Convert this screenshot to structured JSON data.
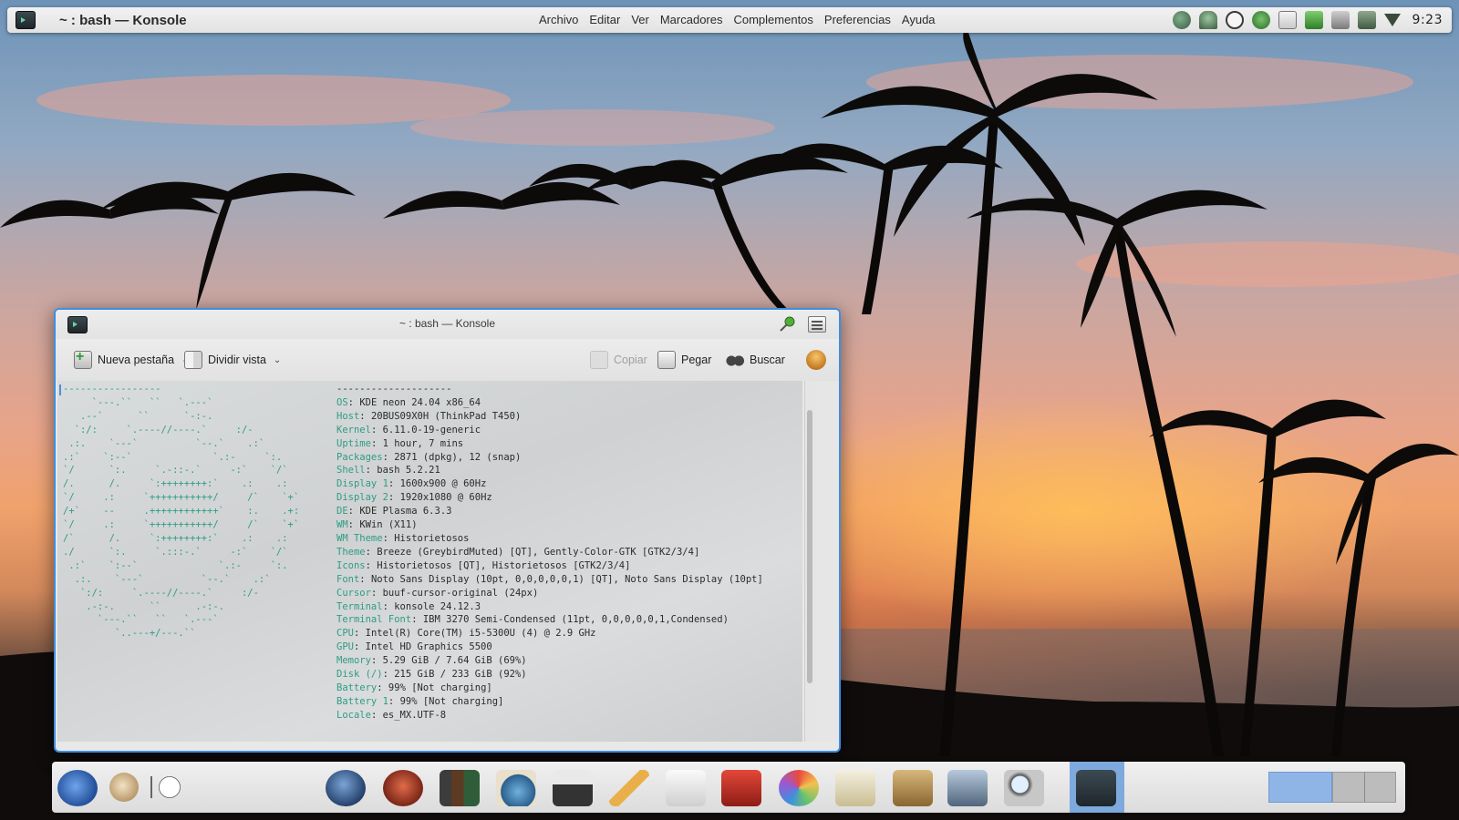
{
  "top_panel": {
    "title": "~ : bash — Konsole",
    "menu": [
      "Archivo",
      "Editar",
      "Ver",
      "Marcadores",
      "Complementos",
      "Preferencias",
      "Ayuda"
    ],
    "tray_icons": [
      "updates-icon",
      "network-share-icon",
      "vpn-icon",
      "bluetooth-icon",
      "clipboard-icon",
      "battery-icon",
      "notes-icon",
      "volume-icon",
      "wifi-icon"
    ],
    "clock": "9:23"
  },
  "konsole": {
    "title": "~ : bash — Konsole",
    "toolbar": {
      "new_tab": "Nueva pestaña",
      "split_view": "Dividir vista",
      "copy": "Copiar",
      "paste": "Pegar",
      "find": "Buscar"
    },
    "logo": "-----------------\n     `---.``   ``   `.---`\n   .--`      ``      `-:-.\n  `:/:     `.----//----.`     :/-\n .:.    `---`          `--.`    .:`\n.:`    `:--`              `.:-     `:.\n`/      `:.     `.-::-.`     -:`    `/`\n/.      /.     `:++++++++:`    .:    .:\n`/     .:     `+++++++++++/     /`    `+`\n/+`    --     .++++++++++++`    :.    .+:\n`/     .:     `+++++++++++/     /`    `+`\n/`      /.     `:++++++++:`    .:    .:\n./      `:.     `.:::-.`     -:`    `/`\n .:`    `:--`              `.:-     `:.\n  .:.    `---`          `--.`    .:`\n   `:/:     `.----//----.`     :/-\n    .-:-.      ``      .-:-.\n      `---.``   ``   `.---`\n         `..---+/---.``",
    "info": [
      {
        "k": "",
        "v": "--------------------"
      },
      {
        "k": "OS",
        "v": "KDE neon 24.04 x86_64"
      },
      {
        "k": "Host",
        "v": "20BUS09X0H (ThinkPad T450)"
      },
      {
        "k": "Kernel",
        "v": "6.11.0-19-generic"
      },
      {
        "k": "Uptime",
        "v": "1 hour, 7 mins"
      },
      {
        "k": "Packages",
        "v": "2871 (dpkg), 12 (snap)"
      },
      {
        "k": "Shell",
        "v": "bash 5.2.21"
      },
      {
        "k": "Display 1",
        "v": "1600x900 @ 60Hz"
      },
      {
        "k": "Display 2",
        "v": "1920x1080 @ 60Hz"
      },
      {
        "k": "DE",
        "v": "KDE Plasma 6.3.3"
      },
      {
        "k": "WM",
        "v": "KWin (X11)"
      },
      {
        "k": "WM Theme",
        "v": "Historietosos"
      },
      {
        "k": "Theme",
        "v": "Breeze (GreybirdMuted) [QT], Gently-Color-GTK [GTK2/3/4]"
      },
      {
        "k": "Icons",
        "v": "Historietosos [QT], Historietosos [GTK2/3/4]"
      },
      {
        "k": "Font",
        "v": "Noto Sans Display (10pt, 0,0,0,0,0,1) [QT], Noto Sans Display (10pt]"
      },
      {
        "k": "Cursor",
        "v": "buuf-cursor-original (24px)"
      },
      {
        "k": "Terminal",
        "v": "konsole 24.12.3"
      },
      {
        "k": "Terminal Font",
        "v": "IBM 3270 Semi-Condensed (11pt, 0,0,0,0,0,1,Condensed)"
      },
      {
        "k": "CPU",
        "v": "Intel(R) Core(TM) i5-5300U (4) @ 2.9 GHz"
      },
      {
        "k": "GPU",
        "v": "Intel HD Graphics 5500"
      },
      {
        "k": "Memory",
        "v": "5.29 GiB / 7.64 GiB (69%)"
      },
      {
        "k": "Disk (/)",
        "v": "215 GiB / 233 GiB (92%)"
      },
      {
        "k": "Battery",
        "v": "99% [Not charging]"
      },
      {
        "k": "Battery 1",
        "v": "99% [Not charging]"
      },
      {
        "k": "Locale",
        "v": "es_MX.UTF-8"
      }
    ]
  },
  "dock": {
    "items": [
      "kde-launcher-icon",
      "palette-icon",
      "circle-icon",
      "bird-icon",
      "fox-icon",
      "books-icon",
      "globe-docs-icon",
      "typewriter-icon",
      "pencil-icon",
      "document-icon",
      "toolbox-icon",
      "color-wheel-icon",
      "notes-pen-icon",
      "cabinet-icon",
      "monitor-icon",
      "search-icon",
      "terminal-icon"
    ]
  }
}
